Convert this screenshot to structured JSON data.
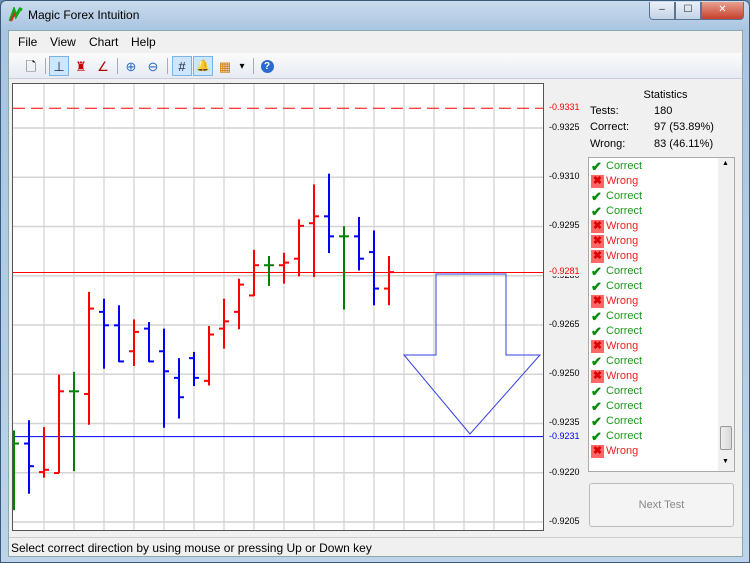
{
  "window": {
    "title": "Magic Forex Intuition",
    "minimize": "–",
    "maximize": "☐",
    "close": "✕"
  },
  "menu": [
    "File",
    "View",
    "Chart",
    "Help"
  ],
  "toolbar": {
    "new": "🗋",
    "bar_chart": "⊥",
    "candle_chart": "♜",
    "line_chart": "∠",
    "zoom_in": "⊕",
    "zoom_out": "⊖",
    "grid": "#",
    "alert": "🔔",
    "colors": "▦",
    "dropdown": "▾",
    "help": "?"
  },
  "statistics": {
    "title": "Statistics",
    "tests_label": "Tests:",
    "tests": "180",
    "correct_label": "Correct:",
    "correct": "97 (53.89%)",
    "wrong_label": "Wrong:",
    "wrong": "83 (46.11%)"
  },
  "results": [
    "Correct",
    "Wrong",
    "Correct",
    "Correct",
    "Wrong",
    "Wrong",
    "Wrong",
    "Correct",
    "Correct",
    "Wrong",
    "Correct",
    "Correct",
    "Wrong",
    "Correct",
    "Wrong",
    "Correct",
    "Correct",
    "Correct",
    "Correct",
    "Wrong"
  ],
  "colors": {
    "correct": "#1a9a1a",
    "wrong": "#f02020",
    "up": "#ff0000",
    "down": "#0000ff",
    "doji": "#008000"
  },
  "next_button": "Next Test",
  "status": "Select correct direction by using mouse or pressing Up or Down key",
  "chart_data": {
    "type": "ohlc",
    "ylim": [
      0.92,
      0.9338
    ],
    "yticks": [
      "0.9325",
      "0.9310",
      "0.9295",
      "0.9280",
      "0.9265",
      "0.9250",
      "0.9235",
      "0.9220",
      "0.9205"
    ],
    "levels": [
      {
        "value": "0.9331",
        "color": "#ff0000",
        "style": "dashed"
      },
      {
        "value": "0.9281",
        "color": "#ff0000",
        "style": "solid"
      },
      {
        "value": "0.9231",
        "color": "#0000ff",
        "style": "solid"
      }
    ],
    "bars": [
      [
        0.92289,
        0.92329,
        0.92086,
        0.92289
      ],
      [
        0.92289,
        0.9236,
        0.92136,
        0.9222
      ],
      [
        0.92202,
        0.92339,
        0.92185,
        0.92209
      ],
      [
        0.92199,
        0.92499,
        0.92199,
        0.92448
      ],
      [
        0.92448,
        0.92507,
        0.92205,
        0.92448
      ],
      [
        0.9244,
        0.92751,
        0.92346,
        0.927
      ],
      [
        0.9269,
        0.9273,
        0.92517,
        0.92649
      ],
      [
        0.92649,
        0.9271,
        0.92537,
        0.92539
      ],
      [
        0.9257,
        0.92667,
        0.92525,
        0.92629
      ],
      [
        0.92639,
        0.92659,
        0.92537,
        0.92539
      ],
      [
        0.9257,
        0.92639,
        0.92337,
        0.92509
      ],
      [
        0.92489,
        0.92549,
        0.92365,
        0.9243
      ],
      [
        0.92549,
        0.92568,
        0.92464,
        0.92489
      ],
      [
        0.9248,
        0.92647,
        0.92466,
        0.92621
      ],
      [
        0.92639,
        0.9273,
        0.92578,
        0.92661
      ],
      [
        0.9269,
        0.92791,
        0.92637,
        0.92773
      ],
      [
        0.9274,
        0.92879,
        0.92738,
        0.92832
      ],
      [
        0.92832,
        0.9286,
        0.92769,
        0.92832
      ],
      [
        0.92832,
        0.9287,
        0.92776,
        0.9284
      ],
      [
        0.92852,
        0.92972,
        0.92798,
        0.92952
      ],
      [
        0.9296,
        0.93078,
        0.92796,
        0.92981
      ],
      [
        0.92981,
        0.93111,
        0.92869,
        0.9292
      ],
      [
        0.9292,
        0.92951,
        0.92697,
        0.9292
      ],
      [
        0.9292,
        0.92979,
        0.92816,
        0.92852
      ],
      [
        0.92872,
        0.92938,
        0.9271,
        0.92761
      ],
      [
        0.92761,
        0.9286,
        0.9271,
        0.92811
      ]
    ],
    "annotation": "down-arrow"
  }
}
